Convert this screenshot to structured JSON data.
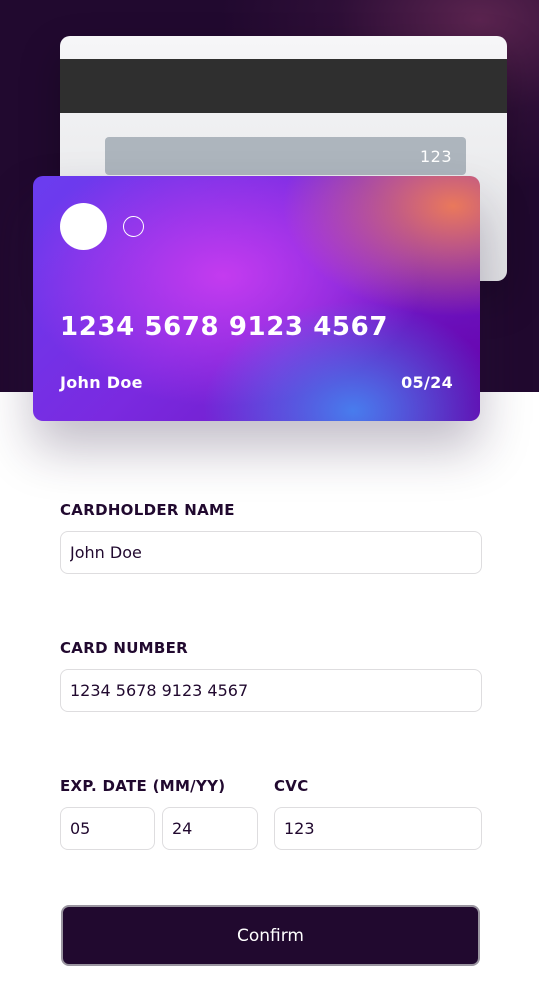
{
  "card_back": {
    "cvc": "123"
  },
  "card_front": {
    "number": "1234 5678 9123 4567",
    "name": "John Doe",
    "expiry": "05/24"
  },
  "form": {
    "cardholder_label": "CARDHOLDER NAME",
    "cardholder_value": "John Doe",
    "number_label": "CARD NUMBER",
    "number_value": "1234 5678 9123 4567",
    "exp_label": "EXP. DATE (MM/YY)",
    "exp_month_value": "05",
    "exp_year_value": "24",
    "cvc_label": "CVC",
    "cvc_value": "123",
    "confirm_label": "Confirm"
  },
  "colors": {
    "dark": "#21092f",
    "card_purple": "#7a2ae0",
    "card_orange": "#f07d55",
    "card_blue": "#4682f0",
    "input_border": "#dedddf"
  }
}
